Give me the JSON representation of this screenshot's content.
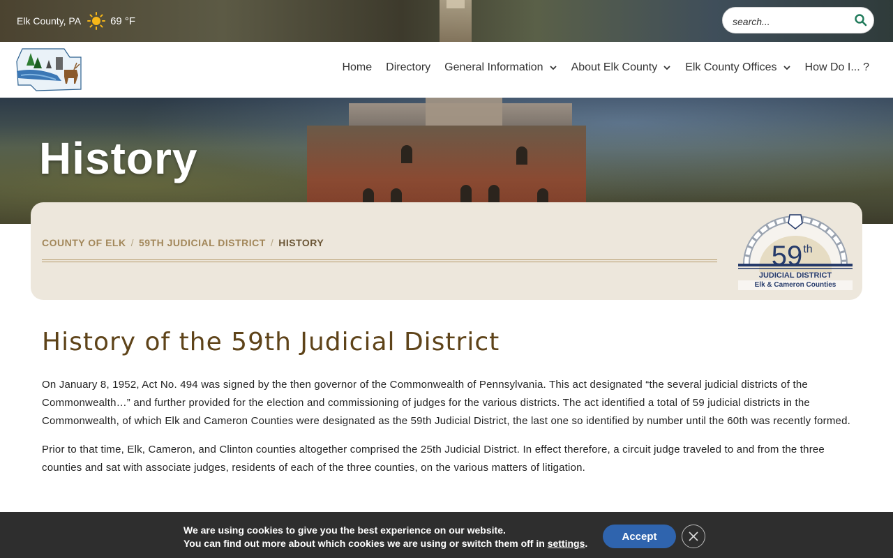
{
  "topbar": {
    "location": "Elk County, PA",
    "weather_icon": "sun-icon",
    "temperature": "69 °F",
    "search_placeholder": "search..."
  },
  "nav": {
    "items": [
      {
        "label": "Home",
        "has_dropdown": false
      },
      {
        "label": "Directory",
        "has_dropdown": false
      },
      {
        "label": "General Information",
        "has_dropdown": true
      },
      {
        "label": "About Elk County",
        "has_dropdown": true
      },
      {
        "label": "Elk County Offices",
        "has_dropdown": true
      },
      {
        "label": "How Do I... ?",
        "has_dropdown": false
      }
    ]
  },
  "hero": {
    "title": "History"
  },
  "breadcrumb": {
    "items": [
      "COUNTY OF ELK",
      "59TH JUDICIAL DISTRICT",
      "HISTORY"
    ],
    "separator": "/"
  },
  "district_logo": {
    "number": "59",
    "suffix": "th",
    "line1": "JUDICIAL DISTRICT",
    "line2": "Elk & Cameron Counties"
  },
  "content": {
    "heading": "History of the 59th Judicial District",
    "paragraphs": [
      "On January 8, 1952, Act No. 494 was signed by the then governor of the Commonwealth of Pennsylvania. This act designated “the several judicial districts of the Commonwealth…” and further provided for the election and commissioning of judges for the various districts. The act identified a total of 59 judicial districts in the Commonwealth, of which Elk and Cameron Counties were designated as the 59th Judicial District, the last one so identified by number until the 60th was recently formed.",
      "Prior to that time, Elk, Cameron, and Clinton counties altogether comprised the 25th Judicial District. In effect therefore, a circuit judge traveled to and from the three counties and sat with associate judges, residents of each of the three counties, on the various matters of litigation."
    ]
  },
  "cookie": {
    "line1": "We are using cookies to give you the best experience on our website.",
    "line2_prefix": "You can find out more about which cookies we are using or switch them off in ",
    "line2_link": "settings",
    "line2_suffix": ".",
    "accept_label": "Accept"
  },
  "colors": {
    "heading": "#5e4319",
    "breadcrumb_link": "#a2875a",
    "card_bg": "#ede7dc",
    "accept_button": "#2f64ae",
    "cookie_bg": "#2e2e2e"
  }
}
